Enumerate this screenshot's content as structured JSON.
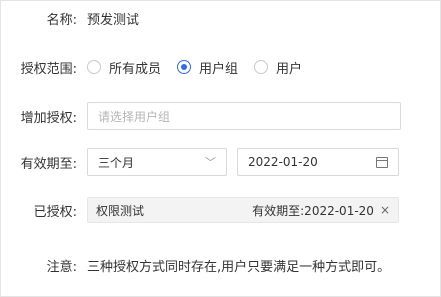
{
  "form": {
    "name": {
      "label": "名称:",
      "value": "预发测试"
    },
    "scope": {
      "label": "授权范围:",
      "options": [
        {
          "label": "所有成员",
          "checked": false
        },
        {
          "label": "用户组",
          "checked": true
        },
        {
          "label": "用户",
          "checked": false
        }
      ]
    },
    "add": {
      "label": "增加授权:",
      "placeholder": "请选择用户组"
    },
    "validity": {
      "label": "有效期至:",
      "duration": "三个月",
      "date": "2022-01-20"
    },
    "granted": {
      "label": "已授权:",
      "tag": {
        "name": "权限测试",
        "expiry": "有效期至:2022-01-20"
      }
    },
    "note": {
      "label": "注意:",
      "text": "三种授权方式同时存在,用户只要满足一种方式即可。"
    }
  },
  "colors": {
    "accent": "#2f6bf1"
  },
  "icons": {
    "chevron": "chevron-down-icon",
    "calendar": "calendar-icon",
    "close": "close-icon"
  }
}
